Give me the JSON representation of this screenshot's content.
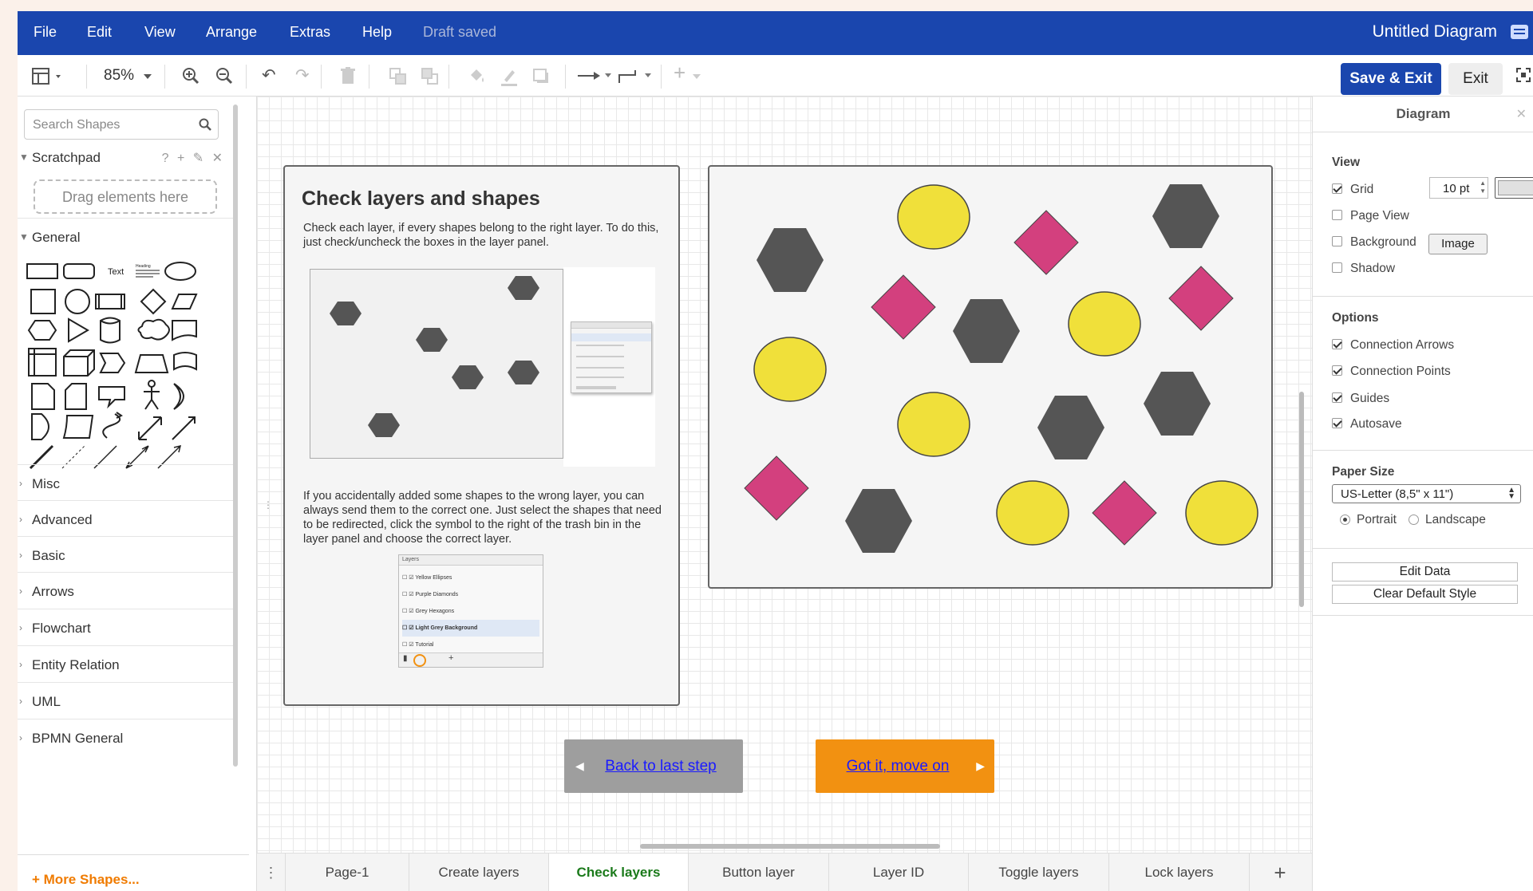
{
  "menubar": {
    "items": [
      "File",
      "Edit",
      "View",
      "Arrange",
      "Extras",
      "Help"
    ],
    "status": "Draft saved",
    "title": "Untitled Diagram",
    "bg_color": "#1a46ae"
  },
  "toolbar": {
    "zoom": "85%",
    "save_label": "Save & Exit",
    "exit_label": "Exit"
  },
  "sidebar": {
    "search_placeholder": "Search Shapes",
    "scratchpad_label": "Scratchpad",
    "scratchpad_tools": "? + ✎ ✕",
    "drag_text": "Drag elements here",
    "general_label": "General",
    "shape_text": "Text",
    "shape_heading": "Heading",
    "categories": [
      "Misc",
      "Advanced",
      "Basic",
      "Arrows",
      "Flowchart",
      "Entity Relation",
      "UML",
      "BPMN General"
    ],
    "more_shapes": "+ More Shapes..."
  },
  "tutorial": {
    "title": "Check layers and shapes",
    "text1": "Check each layer, if every shapes belong to the right layer. To do this, just check/uncheck the boxes in the layer panel.",
    "text2": "If you accidentally added some shapes to the wrong layer, you can always send them to the correct one. Just select the shapes that need to be redirected, click the symbol to the right of the trash bin in the layer panel and choose the correct layer.",
    "layers_panel_title": "Layers",
    "layers": [
      "Yellow Ellipses",
      "Purple Diamonds",
      "Grey Hexagons",
      "Light Grey Background",
      "Tutorial"
    ],
    "back_button": "Back to last step",
    "next_button": "Got it, move on",
    "colors": {
      "yellow": "#f0e03a",
      "pink": "#d3407e",
      "hexagon": "#555555",
      "back_btn": "#9e9e9e",
      "next_btn": "#f29111"
    }
  },
  "pages": {
    "tabs": [
      "Page-1",
      "Create layers",
      "Check layers",
      "Button layer",
      "Layer ID",
      "Toggle layers",
      "Lock layers"
    ],
    "active": "Check layers",
    "add": "+"
  },
  "format_panel": {
    "title": "Diagram",
    "view_label": "View",
    "grid_label": "Grid",
    "grid_size": "10 pt",
    "page_view_label": "Page View",
    "background_label": "Background",
    "image_button": "Image",
    "shadow_label": "Shadow",
    "options_label": "Options",
    "options": [
      "Connection Arrows",
      "Connection Points",
      "Guides",
      "Autosave"
    ],
    "paper_size_label": "Paper Size",
    "paper_size_value": "US-Letter (8,5\" x 11\")",
    "portrait_label": "Portrait",
    "landscape_label": "Landscape",
    "edit_data_button": "Edit Data",
    "clear_style_button": "Clear Default Style"
  }
}
